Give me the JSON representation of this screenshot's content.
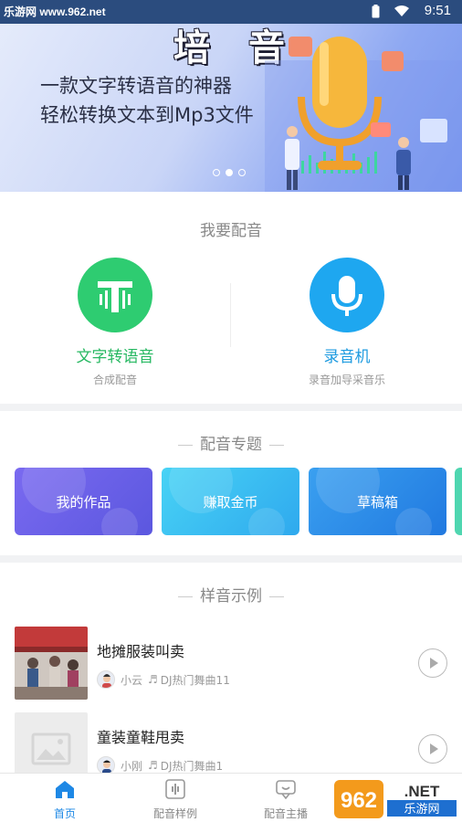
{
  "status_bar": {
    "watermark": "乐游网 www.962.net",
    "time": "9:51"
  },
  "banner": {
    "brand": "培音",
    "headline": "一款文字转语音的神器",
    "subline": "轻松转换文本到Mp3文件",
    "page_indicator": {
      "count": 3,
      "active": 2
    }
  },
  "dubbing": {
    "section_title": "我要配音",
    "tools": [
      {
        "name": "文字转语音",
        "sub": "合成配音",
        "color": "#2ecc71"
      },
      {
        "name": "录音机",
        "sub": "录音加导采音乐",
        "color": "#1ea7f0"
      }
    ]
  },
  "topics": {
    "section_title": "配音专题",
    "tiles": [
      {
        "label": "我的作品",
        "color": "#6e63e6"
      },
      {
        "label": "赚取金币",
        "color": "#3cc6f0"
      },
      {
        "label": "草稿箱",
        "color": "#2f8fe8"
      }
    ]
  },
  "samples": {
    "section_title": "样音示例",
    "items": [
      {
        "title": "地摊服装叫卖",
        "author": "小云",
        "music": "DJ热门舞曲11"
      },
      {
        "title": "童装童鞋甩卖",
        "author": "小刚",
        "music": "DJ热门舞曲1"
      }
    ]
  },
  "tabbar": {
    "tabs": [
      {
        "label": "首页",
        "icon": "home-icon",
        "active": true
      },
      {
        "label": "配音样例",
        "icon": "waveform-icon",
        "active": false
      },
      {
        "label": "配音主播",
        "icon": "host-icon",
        "active": false
      }
    ]
  },
  "corner_watermark": "962.NET 乐游网"
}
